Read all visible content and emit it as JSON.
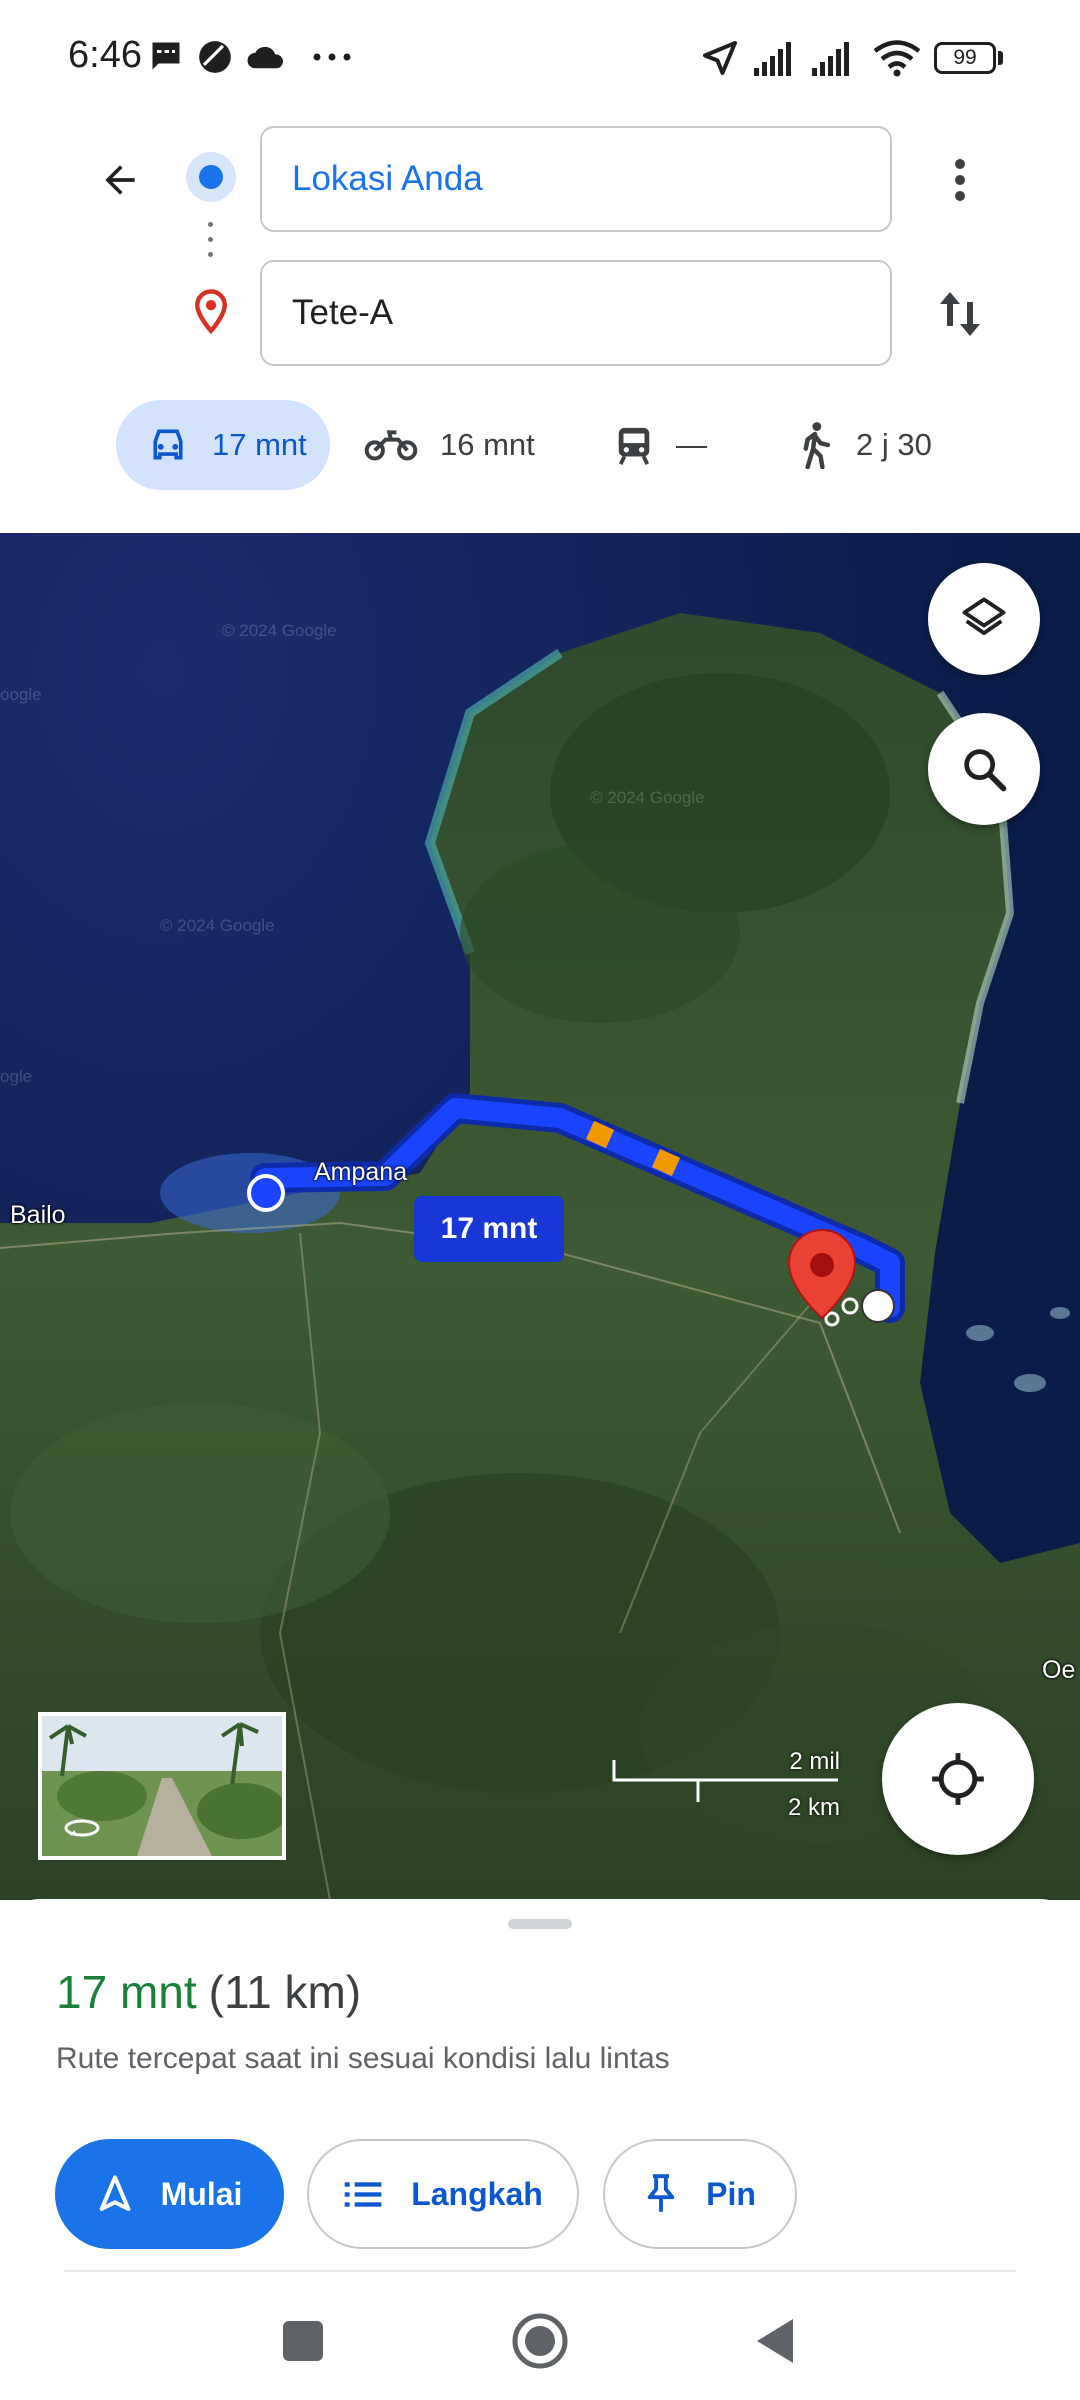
{
  "status_bar": {
    "time": "6:46",
    "battery": "99",
    "icons": [
      "message-icon",
      "no-disturb-icon",
      "cloud-icon",
      "more-dots-icon",
      "location-arrow-icon",
      "signal-icon",
      "signal-icon",
      "wifi-icon",
      "battery-icon"
    ]
  },
  "route": {
    "origin": "Lokasi Anda",
    "destination": "Tete-A"
  },
  "modes": [
    {
      "name": "car",
      "label": "17 mnt",
      "selected": true
    },
    {
      "name": "motorcycle",
      "label": "16 mnt",
      "selected": false
    },
    {
      "name": "transit",
      "label": "—",
      "selected": false
    },
    {
      "name": "walk",
      "label": "2 j 30",
      "selected": false
    }
  ],
  "map": {
    "labels": {
      "bailo": "Bailo",
      "ampana": "Ampana",
      "oe": "Oe"
    },
    "route_badge": "17 mnt",
    "watermarks": [
      "© 2024 Google",
      "© 2024 Google",
      "© 2024 Google",
      "oogle",
      "ogle"
    ],
    "scale": {
      "miles": "2 mil",
      "km": "2 km"
    },
    "colors": {
      "route": "#1a44ff",
      "traffic": "#f29900",
      "pin": "#ea4335"
    }
  },
  "sheet": {
    "duration": "17 mnt",
    "distance": "(11 km)",
    "note": "Rute tercepat saat ini sesuai kondisi lalu lintas",
    "start_label": "Mulai",
    "steps_label": "Langkah",
    "pin_label": "Pin"
  },
  "colors": {
    "accent": "#1a73e8",
    "duration_green": "#188038"
  }
}
